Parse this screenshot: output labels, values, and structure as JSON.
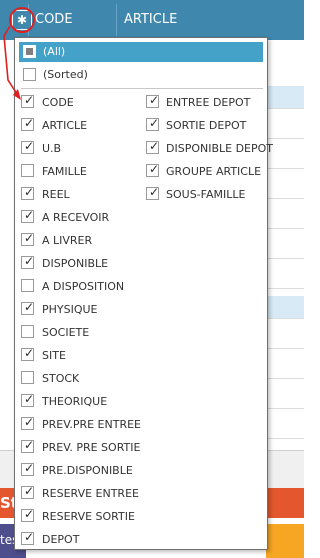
{
  "grid": {
    "columns": [
      "CODE",
      "ARTICLE"
    ],
    "bottom_banner_text": "St",
    "footer_left_text": "tes"
  },
  "gear_icon": "gear-icon",
  "popup": {
    "all_label": "(All)",
    "sorted_label": "(Sorted)",
    "left_items": [
      {
        "label": "CODE",
        "checked": true
      },
      {
        "label": "ARTICLE",
        "checked": true
      },
      {
        "label": "U.B",
        "checked": true
      },
      {
        "label": "FAMILLE",
        "checked": false
      },
      {
        "label": "REEL",
        "checked": true
      },
      {
        "label": "A RECEVOIR",
        "checked": true
      },
      {
        "label": "A LIVRER",
        "checked": true
      },
      {
        "label": "DISPONIBLE",
        "checked": true
      },
      {
        "label": "A DISPOSITION",
        "checked": false
      },
      {
        "label": "PHYSIQUE",
        "checked": true
      },
      {
        "label": "SOCIETE",
        "checked": false
      },
      {
        "label": "SITE",
        "checked": true
      },
      {
        "label": "STOCK",
        "checked": false
      },
      {
        "label": "THEORIQUE",
        "checked": true
      },
      {
        "label": "PREV.PRE ENTREE",
        "checked": true
      },
      {
        "label": "PREV. PRE SORTIE",
        "checked": true
      },
      {
        "label": "PRE.DISPONIBLE",
        "checked": true
      },
      {
        "label": "RESERVE ENTREE",
        "checked": true
      },
      {
        "label": "RESERVE SORTIE",
        "checked": true
      },
      {
        "label": "DEPOT",
        "checked": true
      }
    ],
    "right_items": [
      {
        "label": "ENTREE DEPOT",
        "checked": true
      },
      {
        "label": "SORTIE DEPOT",
        "checked": true
      },
      {
        "label": "DISPONIBLE DEPOT",
        "checked": true
      },
      {
        "label": "GROUPE ARTICLE",
        "checked": true
      },
      {
        "label": "SOUS-FAMILLE",
        "checked": true
      }
    ]
  }
}
